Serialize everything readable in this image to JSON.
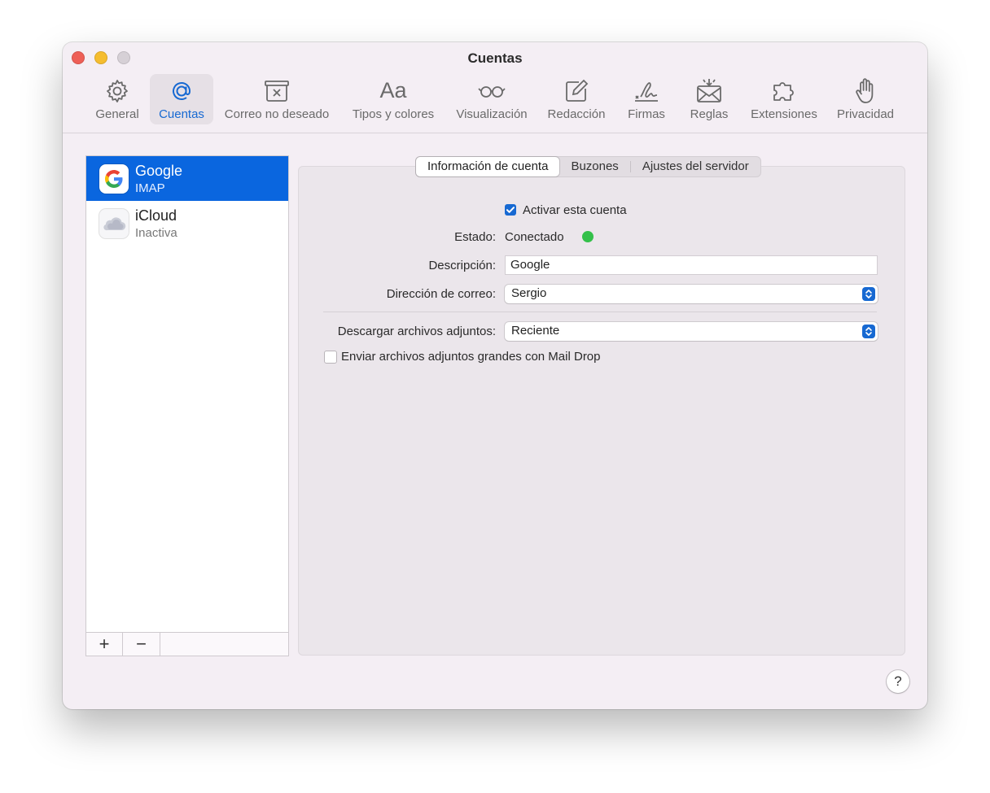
{
  "window": {
    "title": "Cuentas"
  },
  "toolbar": {
    "items": [
      {
        "label": "General",
        "icon": "gear-icon"
      },
      {
        "label": "Cuentas",
        "icon": "at-sign-icon",
        "active": true
      },
      {
        "label": "Correo no deseado",
        "icon": "junk-bin-icon"
      },
      {
        "label": "Tipos y colores",
        "icon": "font-aa-icon"
      },
      {
        "label": "Visualización",
        "icon": "glasses-icon"
      },
      {
        "label": "Redacción",
        "icon": "compose-icon"
      },
      {
        "label": "Firmas",
        "icon": "signature-icon"
      },
      {
        "label": "Reglas",
        "icon": "rules-envelope-icon"
      },
      {
        "label": "Extensiones",
        "icon": "puzzle-icon"
      },
      {
        "label": "Privacidad",
        "icon": "hand-icon"
      }
    ],
    "font_glyph": "Aa"
  },
  "sidebar": {
    "accounts": [
      {
        "name": "Google",
        "type": "IMAP",
        "icon": "google-icon",
        "selected": true
      },
      {
        "name": "iCloud",
        "type": "Inactiva",
        "icon": "icloud-icon",
        "selected": false
      }
    ],
    "add_label": "+",
    "remove_label": "−"
  },
  "tabs": [
    {
      "label": "Información de cuenta",
      "active": true
    },
    {
      "label": "Buzones",
      "active": false
    },
    {
      "label": "Ajustes del servidor",
      "active": false
    }
  ],
  "form": {
    "enable_account": {
      "label": "Activar esta cuenta",
      "checked": true
    },
    "status": {
      "label": "Estado:",
      "value": "Conectado",
      "color": "#34c04a"
    },
    "description": {
      "label": "Descripción:",
      "value": "Google"
    },
    "email": {
      "label": "Dirección de correo:",
      "value": "Sergio"
    },
    "download_attachments": {
      "label": "Descargar archivos adjuntos:",
      "value": "Reciente"
    },
    "mail_drop": {
      "label": "Enviar archivos adjuntos grandes con Mail Drop",
      "checked": false
    }
  },
  "help": {
    "label": "?"
  },
  "colors": {
    "accent": "#1769d2",
    "selection": "#0a66df",
    "window_bg": "#f4eef4"
  }
}
